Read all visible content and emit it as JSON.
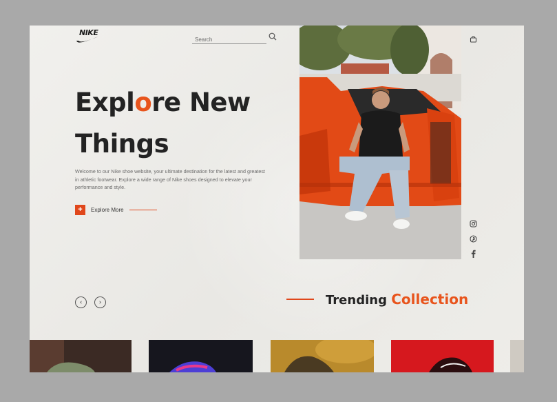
{
  "brand": {
    "logo_text": "NIKE"
  },
  "search": {
    "placeholder": "Search"
  },
  "hero": {
    "title_part1": "Expl",
    "title_accent": "o",
    "title_part2": "re New",
    "title_line2": "Things",
    "description": "Welcome to our Nike shoe website, your ultimate destination for the latest and greatest in athletic footwear. Explore a wide range of Nike shoes designed to elevate your performance and style.",
    "cta_icon": "+",
    "cta_label": "Explore More"
  },
  "sidebar": {
    "icons": [
      "bag-icon",
      "instagram-icon",
      "pinterest-icon",
      "facebook-icon"
    ]
  },
  "trending": {
    "title_plain": "Trending",
    "title_accent": "Collection"
  },
  "carousel": {
    "prev_icon": "‹",
    "next_icon": "›"
  },
  "cards": [
    {
      "name": "product-card-1"
    },
    {
      "name": "product-card-2"
    },
    {
      "name": "product-card-3"
    },
    {
      "name": "product-card-4"
    }
  ],
  "colors": {
    "accent": "#e8541c",
    "text": "#232323",
    "frame": "#a9a9a9"
  }
}
